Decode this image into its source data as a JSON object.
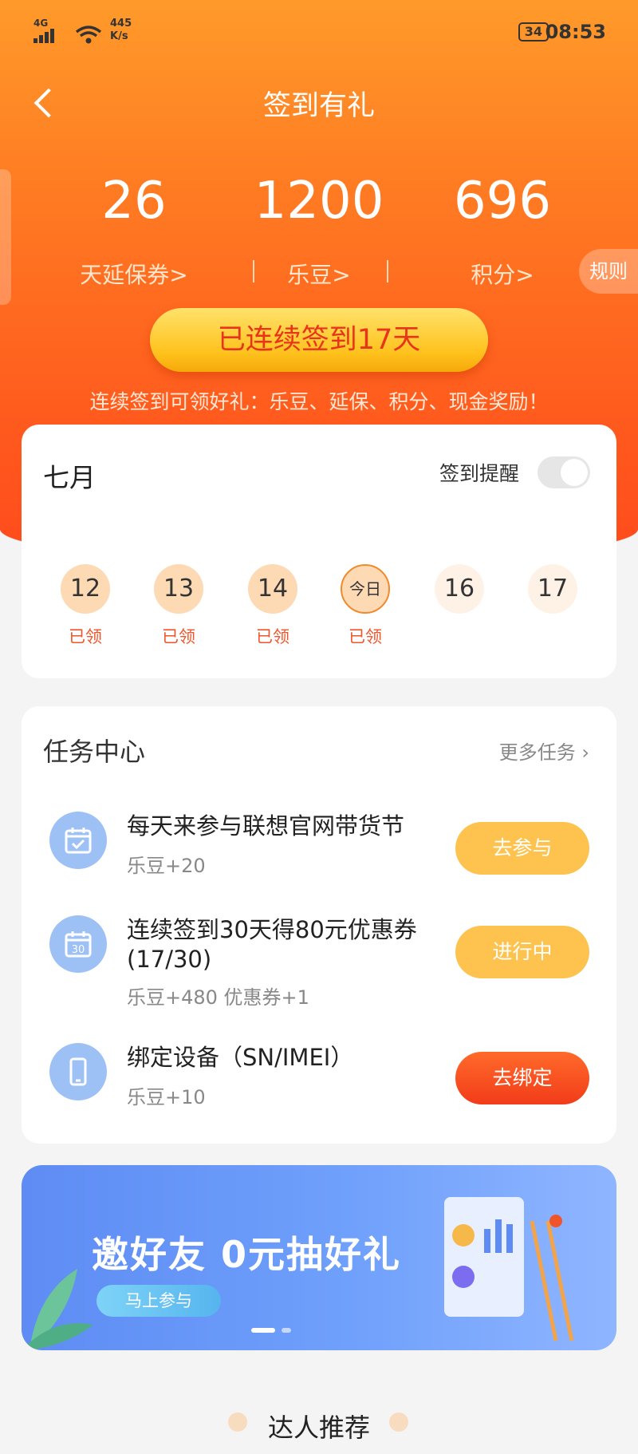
{
  "status_bar": {
    "network": "4G",
    "speed_value": "445",
    "speed_unit": "K/s",
    "battery": "34",
    "time": "08:53"
  },
  "nav": {
    "title": "签到有礼"
  },
  "stats": [
    {
      "value": "26",
      "label": "天延保券>"
    },
    {
      "value": "1200",
      "label": "乐豆>"
    },
    {
      "value": "696",
      "label": "积分>"
    }
  ],
  "rule_label": "规则",
  "streak": {
    "label": "已连续签到17天",
    "note": "连续签到可领好礼：乐豆、延保、积分、现金奖励！"
  },
  "calendar": {
    "month": "七月",
    "reminder_label": "签到提醒",
    "reminder_on": false,
    "days": [
      {
        "label": "12",
        "status": "已领"
      },
      {
        "label": "13",
        "status": "已领"
      },
      {
        "label": "14",
        "status": "已领"
      },
      {
        "label": "今日",
        "status": "已领"
      },
      {
        "label": "16",
        "status": ""
      },
      {
        "label": "17",
        "status": ""
      }
    ]
  },
  "tasks": {
    "title": "任务中心",
    "more": "更多任务 ›",
    "items": [
      {
        "icon": "calendar-check-icon",
        "title": "每天来参与联想官网带货节",
        "reward": "乐豆+20",
        "button": "去参与"
      },
      {
        "icon": "calendar-30-icon",
        "title": "连续签到30天得80元优惠券 (17/30)",
        "reward": "乐豆+480 优惠券+1",
        "button": "进行中"
      },
      {
        "icon": "phone-icon",
        "title": "绑定设备（SN/IMEI）",
        "reward": "乐豆+10",
        "button": "去绑定"
      }
    ]
  },
  "banner": {
    "title": "邀好友 0元抽好礼",
    "button": "马上参与"
  },
  "recommend": {
    "title": "达人推荐"
  }
}
